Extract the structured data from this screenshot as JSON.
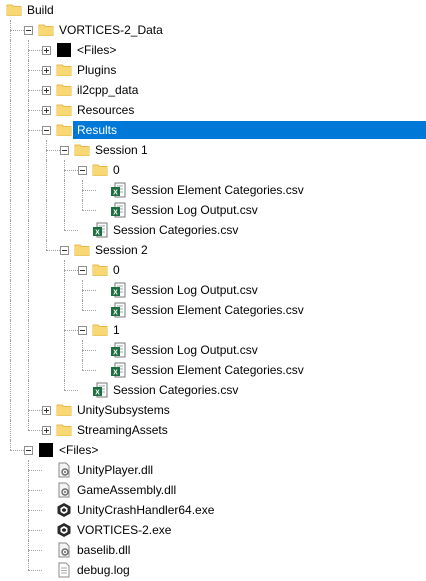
{
  "tree": [
    {
      "label": "Build",
      "depth": 0,
      "icon": "folder-icon",
      "toggle": "none"
    },
    {
      "label": "VORTICES-2_Data",
      "depth": 1,
      "icon": "folder-icon",
      "toggle": "expanded"
    },
    {
      "label": "<Files>",
      "depth": 2,
      "icon": "black-square-icon",
      "toggle": "collapsed"
    },
    {
      "label": "Plugins",
      "depth": 2,
      "icon": "folder-icon",
      "toggle": "collapsed"
    },
    {
      "label": "il2cpp_data",
      "depth": 2,
      "icon": "folder-icon",
      "toggle": "collapsed"
    },
    {
      "label": "Resources",
      "depth": 2,
      "icon": "folder-icon",
      "toggle": "collapsed"
    },
    {
      "label": "Results",
      "depth": 2,
      "icon": "folder-icon",
      "toggle": "expanded",
      "selected": true
    },
    {
      "label": "Session 1",
      "depth": 3,
      "icon": "folder-icon",
      "toggle": "expanded"
    },
    {
      "label": "0",
      "depth": 4,
      "icon": "folder-icon",
      "toggle": "expanded"
    },
    {
      "label": "Session Element Categories.csv",
      "depth": 5,
      "icon": "excel-csv-icon",
      "toggle": "none"
    },
    {
      "label": "Session Log Output.csv",
      "depth": 5,
      "icon": "excel-csv-icon",
      "toggle": "none"
    },
    {
      "label": "Session Categories.csv",
      "depth": 4,
      "icon": "excel-csv-icon",
      "toggle": "none"
    },
    {
      "label": "Session 2",
      "depth": 3,
      "icon": "folder-icon",
      "toggle": "expanded"
    },
    {
      "label": "0",
      "depth": 4,
      "icon": "folder-icon",
      "toggle": "expanded"
    },
    {
      "label": "Session Log Output.csv",
      "depth": 5,
      "icon": "excel-csv-icon",
      "toggle": "none"
    },
    {
      "label": "Session Element Categories.csv",
      "depth": 5,
      "icon": "excel-csv-icon",
      "toggle": "none"
    },
    {
      "label": "1",
      "depth": 4,
      "icon": "folder-icon",
      "toggle": "expanded"
    },
    {
      "label": "Session Log Output.csv",
      "depth": 5,
      "icon": "excel-csv-icon",
      "toggle": "none"
    },
    {
      "label": "Session Element Categories.csv",
      "depth": 5,
      "icon": "excel-csv-icon",
      "toggle": "none"
    },
    {
      "label": "Session Categories.csv",
      "depth": 4,
      "icon": "excel-csv-icon",
      "toggle": "none"
    },
    {
      "label": "UnitySubsystems",
      "depth": 2,
      "icon": "folder-icon",
      "toggle": "collapsed"
    },
    {
      "label": "StreamingAssets",
      "depth": 2,
      "icon": "folder-icon",
      "toggle": "collapsed"
    },
    {
      "label": "<Files>",
      "depth": 1,
      "icon": "black-square-icon",
      "toggle": "expanded"
    },
    {
      "label": "UnityPlayer.dll",
      "depth": 2,
      "icon": "dll-file-icon",
      "toggle": "none"
    },
    {
      "label": "GameAssembly.dll",
      "depth": 2,
      "icon": "dll-file-icon",
      "toggle": "none"
    },
    {
      "label": "UnityCrashHandler64.exe",
      "depth": 2,
      "icon": "unity-exe-icon",
      "toggle": "none"
    },
    {
      "label": "VORTICES-2.exe",
      "depth": 2,
      "icon": "unity-exe-icon",
      "toggle": "none"
    },
    {
      "label": "baselib.dll",
      "depth": 2,
      "icon": "dll-file-icon",
      "toggle": "none"
    },
    {
      "label": "debug.log",
      "depth": 2,
      "icon": "text-file-icon",
      "toggle": "none"
    }
  ],
  "colors": {
    "selection": "#0078d7",
    "folder": "#f8d775",
    "folder_dark": "#e8b84a",
    "excel_green": "#1d6f42",
    "tree_lines": "#a0a0a0"
  }
}
